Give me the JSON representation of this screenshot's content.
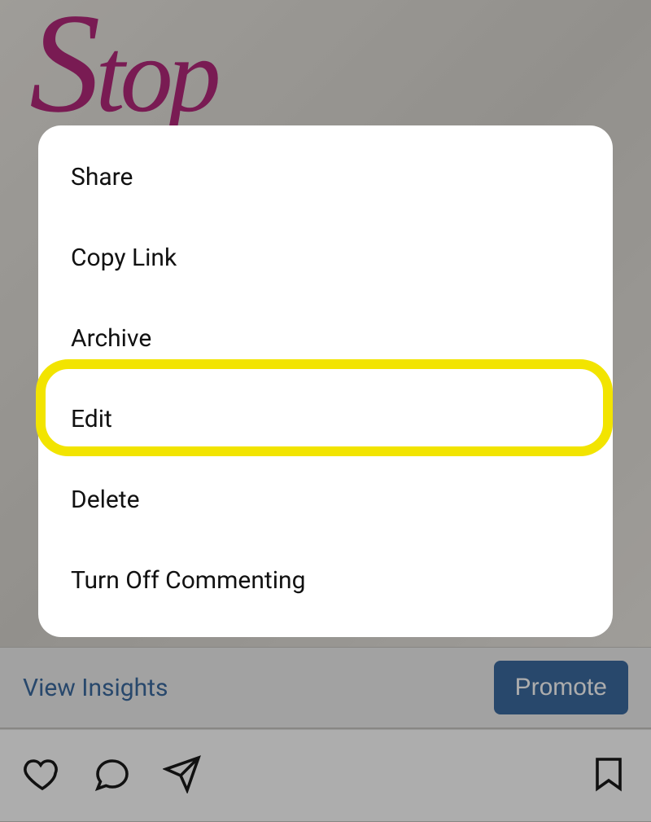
{
  "post": {
    "image_text": "Stop"
  },
  "actions": {
    "view_insights": "View Insights",
    "promote": "Promote"
  },
  "menu": {
    "items": [
      {
        "label": "Share"
      },
      {
        "label": "Copy Link"
      },
      {
        "label": "Archive"
      },
      {
        "label": "Edit"
      },
      {
        "label": "Delete"
      },
      {
        "label": "Turn Off Commenting"
      }
    ],
    "highlighted_index": 3
  }
}
